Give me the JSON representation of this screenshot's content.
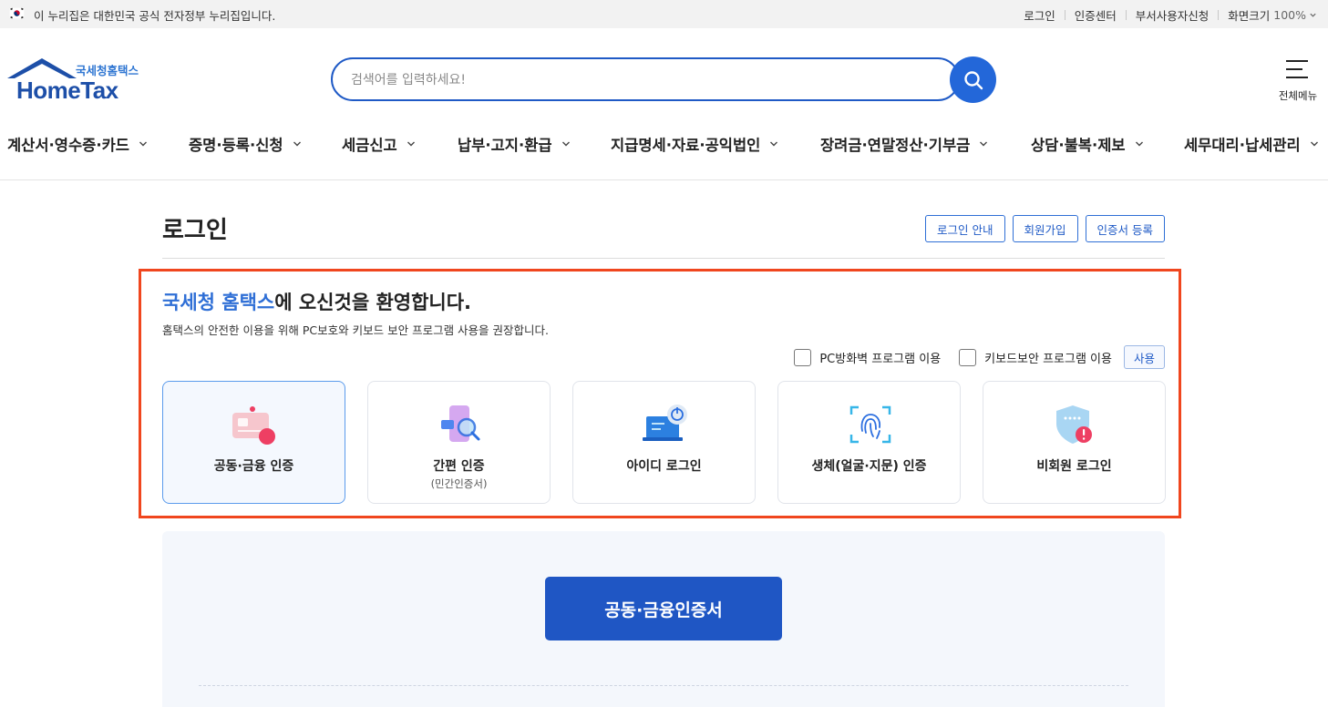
{
  "gov_banner": {
    "text": "이 누리집은 대한민국 공식 전자정부 누리집입니다.",
    "links": [
      "로그인",
      "인증센터",
      "부서사용자신청",
      "화면크기"
    ],
    "zoom": "100%"
  },
  "logo": {
    "sub": "국세청홈택스",
    "main": "HomeTax"
  },
  "search": {
    "placeholder": "검색어를 입력하세요!",
    "value": ""
  },
  "all_menu_label": "전체메뉴",
  "gnb": [
    "계산서·영수증·카드",
    "증명·등록·신청",
    "세금신고",
    "납부·고지·환급",
    "지급명세·자료·공익법인",
    "장려금·연말정산·기부금",
    "상담·불복·제보",
    "세무대리·납세관리"
  ],
  "page": {
    "title": "로그인",
    "buttons": [
      "로그인 안내",
      "회원가입",
      "인증서 등록"
    ]
  },
  "welcome": {
    "brand": "국세청 홈택스",
    "rest": "에 오신것을 환영합니다.",
    "sub": "홈택스의 안전한 이용을 위해 PC보호와 키보드 보안 프로그램 사용을 권장합니다."
  },
  "security": {
    "firewall_label": "PC방화벽 프로그램 이용",
    "keyboard_label": "키보드보안 프로그램 이용",
    "use_button": "사용",
    "firewall_checked": false,
    "keyboard_checked": false
  },
  "login_methods": [
    {
      "title": "공동·금융 인증",
      "sub": "",
      "icon": "certificate-card-icon",
      "active": true
    },
    {
      "title": "간편 인증",
      "sub": "(민간인증서)",
      "icon": "phone-search-icon",
      "active": false
    },
    {
      "title": "아이디 로그인",
      "sub": "",
      "icon": "laptop-power-icon",
      "active": false
    },
    {
      "title": "생체(얼굴·지문) 인증",
      "sub": "",
      "icon": "fingerprint-icon",
      "active": false
    },
    {
      "title": "비회원 로그인",
      "sub": "",
      "icon": "shield-icon",
      "active": false
    }
  ],
  "primary_button": "공동·금융인증서",
  "colors": {
    "brand_blue": "#1f56c4",
    "highlight_border": "#f0461e",
    "link_blue": "#2f6fd6"
  }
}
